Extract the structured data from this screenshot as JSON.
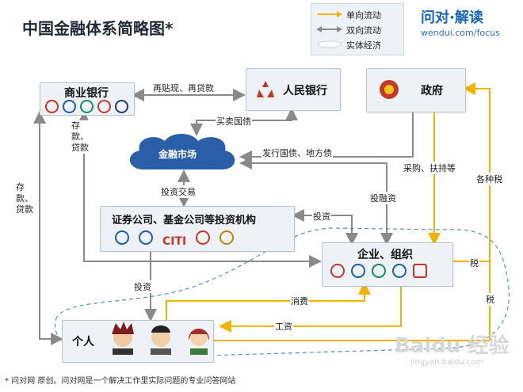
{
  "title": "中国金融体系简略图*",
  "legend": {
    "one_way": "单向流动",
    "two_way": "双向流动",
    "real_economy": "实体经济"
  },
  "logo": {
    "main": "问对·解读",
    "sub": "wendui.com/focus"
  },
  "nodes": {
    "commercial_bank": "商业银行",
    "central_bank": "人民银行",
    "government": "政府",
    "financial_market": "金融市场",
    "securities": "证券公司、基金公司等投资机构",
    "enterprise": "企业、组织",
    "individual": "个人"
  },
  "flows": {
    "rediscount": "再贴现、再贷款",
    "buy_sell_bonds": "买卖国债",
    "issue_bonds": "发行国债、地方债",
    "investment_trade": "投资交易",
    "deposit_loan_bank_market": "存款、贷款",
    "deposit_loan_individual": "存款、贷款",
    "invest_sec_ent": "投资",
    "invest_financing": "投融资",
    "procurement": "采购、扶持等",
    "various_taxes": "各种税",
    "tax_enterprise": "税",
    "tax_individual": "税",
    "invest_individual": "投资",
    "consumption": "消费",
    "wages": "工资"
  },
  "securities_logos": {
    "citi": "CITI"
  },
  "footnote": "* 问对网      原创。问对网是一个解决工作里实际问题的专业问答网站",
  "watermark": {
    "main": "Baidu 经验",
    "sub": "jingyan.baidu.com"
  },
  "colors": {
    "one_way": "#f0b400",
    "two_way": "#8a8a8a",
    "real_economy": "#5b8fb9",
    "cloud": "#2a5fa8",
    "box_bg": "#eef2f6",
    "bank_red": "#c0392b"
  }
}
